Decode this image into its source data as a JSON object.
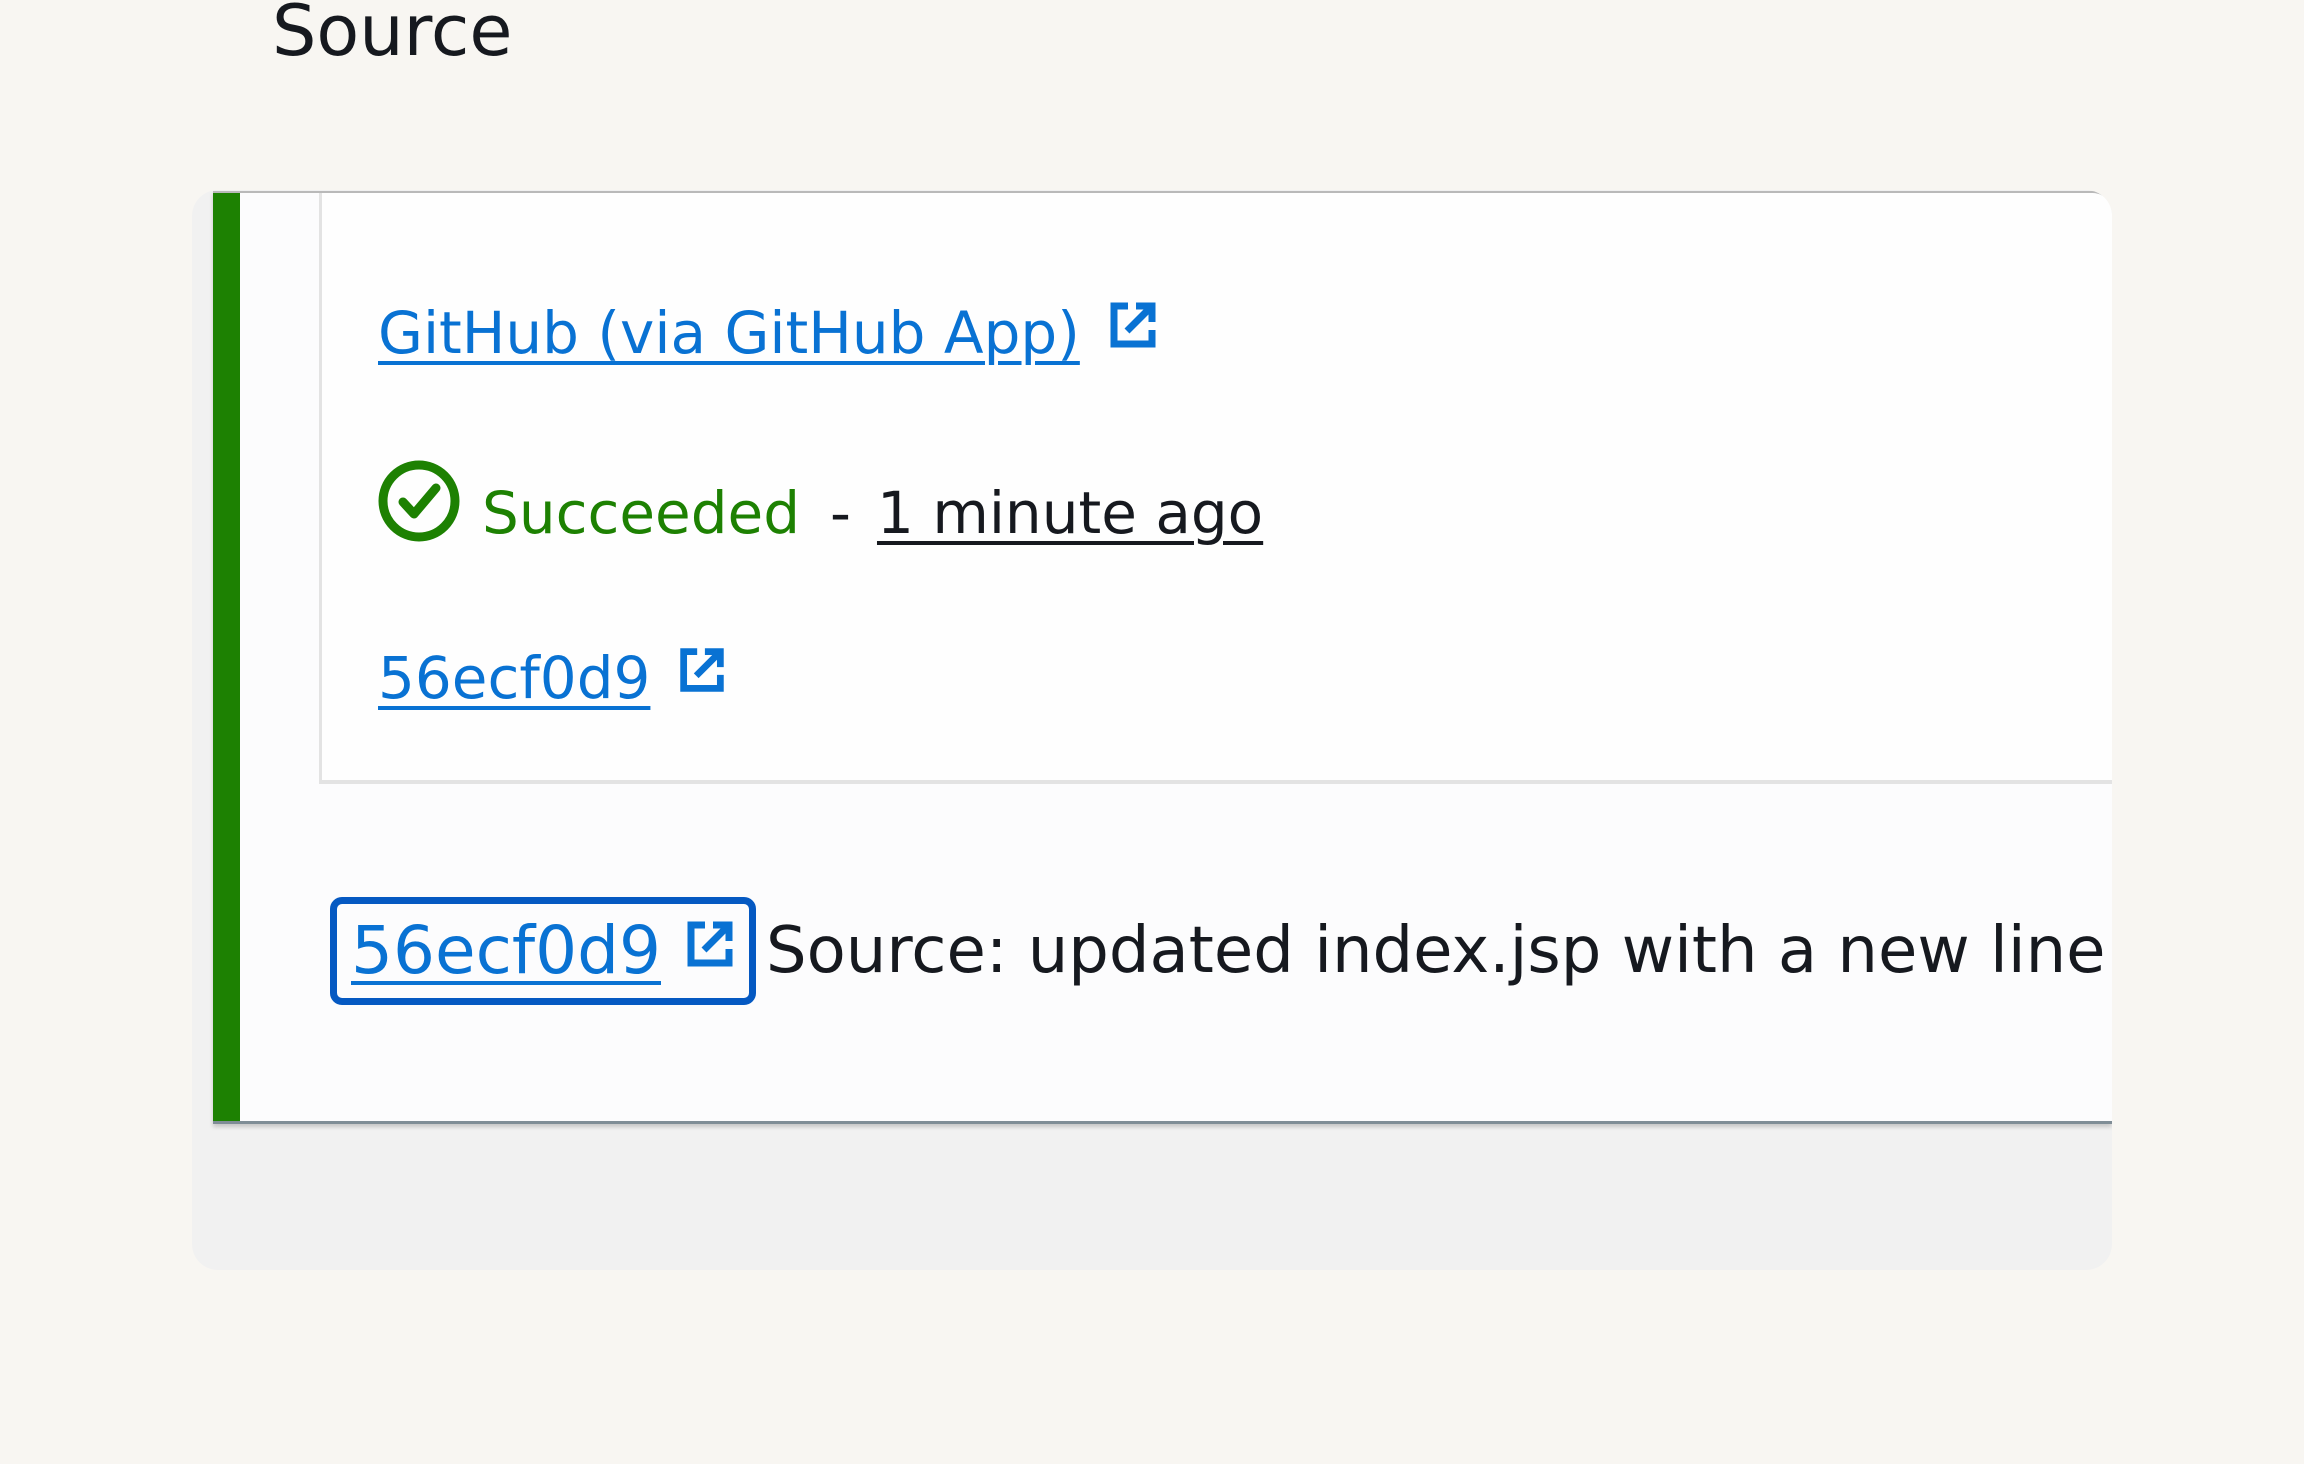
{
  "source_panel": {
    "title": "Source",
    "provider_link": "GitHub (via GitHub App)",
    "status": "Succeeded",
    "status_separator": "-",
    "timestamp": "1 minute ago",
    "commit_link": "56ecf0d9"
  },
  "action": {
    "commit_link": "56ecf0d9",
    "message": "Source: updated index.jsp with a new line"
  },
  "icons": {
    "external_link": "external-link-icon",
    "status": "check-circle-icon"
  },
  "colors": {
    "success": "#1d8102",
    "link": "#0972d3",
    "focus_ring": "#0559c2",
    "text": "#16191f"
  }
}
